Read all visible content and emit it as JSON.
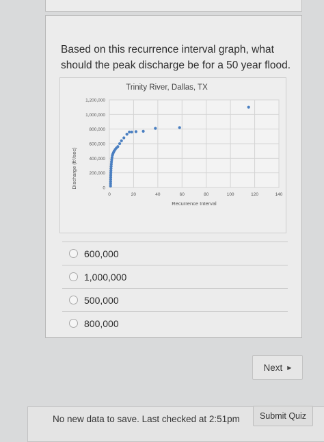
{
  "question": {
    "text": "Based on this recurrence interval graph, what should the peak discharge be for a 50 year flood."
  },
  "chart_data": {
    "type": "scatter",
    "title": "Trinity River, Dallas, TX",
    "xlabel": "Recurrence Interval",
    "ylabel": "Discharge (ft³/sec)",
    "xlim": [
      0,
      140
    ],
    "ylim": [
      0,
      1200000
    ],
    "xticks": [
      "0",
      "20",
      "40",
      "60",
      "80",
      "100",
      "120",
      "140"
    ],
    "yticks": [
      "0",
      "200,000",
      "400,000",
      "600,000",
      "800,000",
      "1,000,000",
      "1,200,000"
    ],
    "grid": true,
    "point_color": "#4a7fc1",
    "points": [
      [
        1.0,
        20000
      ],
      [
        1.02,
        50000
      ],
      [
        1.05,
        80000
      ],
      [
        1.08,
        110000
      ],
      [
        1.12,
        140000
      ],
      [
        1.17,
        170000
      ],
      [
        1.23,
        200000
      ],
      [
        1.3,
        230000
      ],
      [
        1.38,
        260000
      ],
      [
        1.48,
        290000
      ],
      [
        1.6,
        320000
      ],
      [
        1.75,
        350000
      ],
      [
        1.95,
        380000
      ],
      [
        2.2,
        410000
      ],
      [
        2.5,
        440000
      ],
      [
        2.9,
        460000
      ],
      [
        3.4,
        480000
      ],
      [
        4.0,
        500000
      ],
      [
        4.8,
        520000
      ],
      [
        5.8,
        540000
      ],
      [
        7.0,
        560000
      ],
      [
        8.5,
        600000
      ],
      [
        10.0,
        640000
      ],
      [
        12.0,
        680000
      ],
      [
        14.5,
        730000
      ],
      [
        16.5,
        760000
      ],
      [
        18.5,
        760000
      ],
      [
        22.0,
        765000
      ],
      [
        28.0,
        770000
      ],
      [
        38.0,
        810000
      ],
      [
        58.0,
        820000
      ],
      [
        115.0,
        1100000
      ]
    ]
  },
  "options": [
    {
      "label": "600,000"
    },
    {
      "label": "1,000,000"
    },
    {
      "label": "500,000"
    },
    {
      "label": "800,000"
    }
  ],
  "nav": {
    "next_label": "Next",
    "next_icon": "triangle-right-icon"
  },
  "status": {
    "text": "No new data to save. Last checked at 2:51pm",
    "submit_label": "Submit Quiz"
  }
}
